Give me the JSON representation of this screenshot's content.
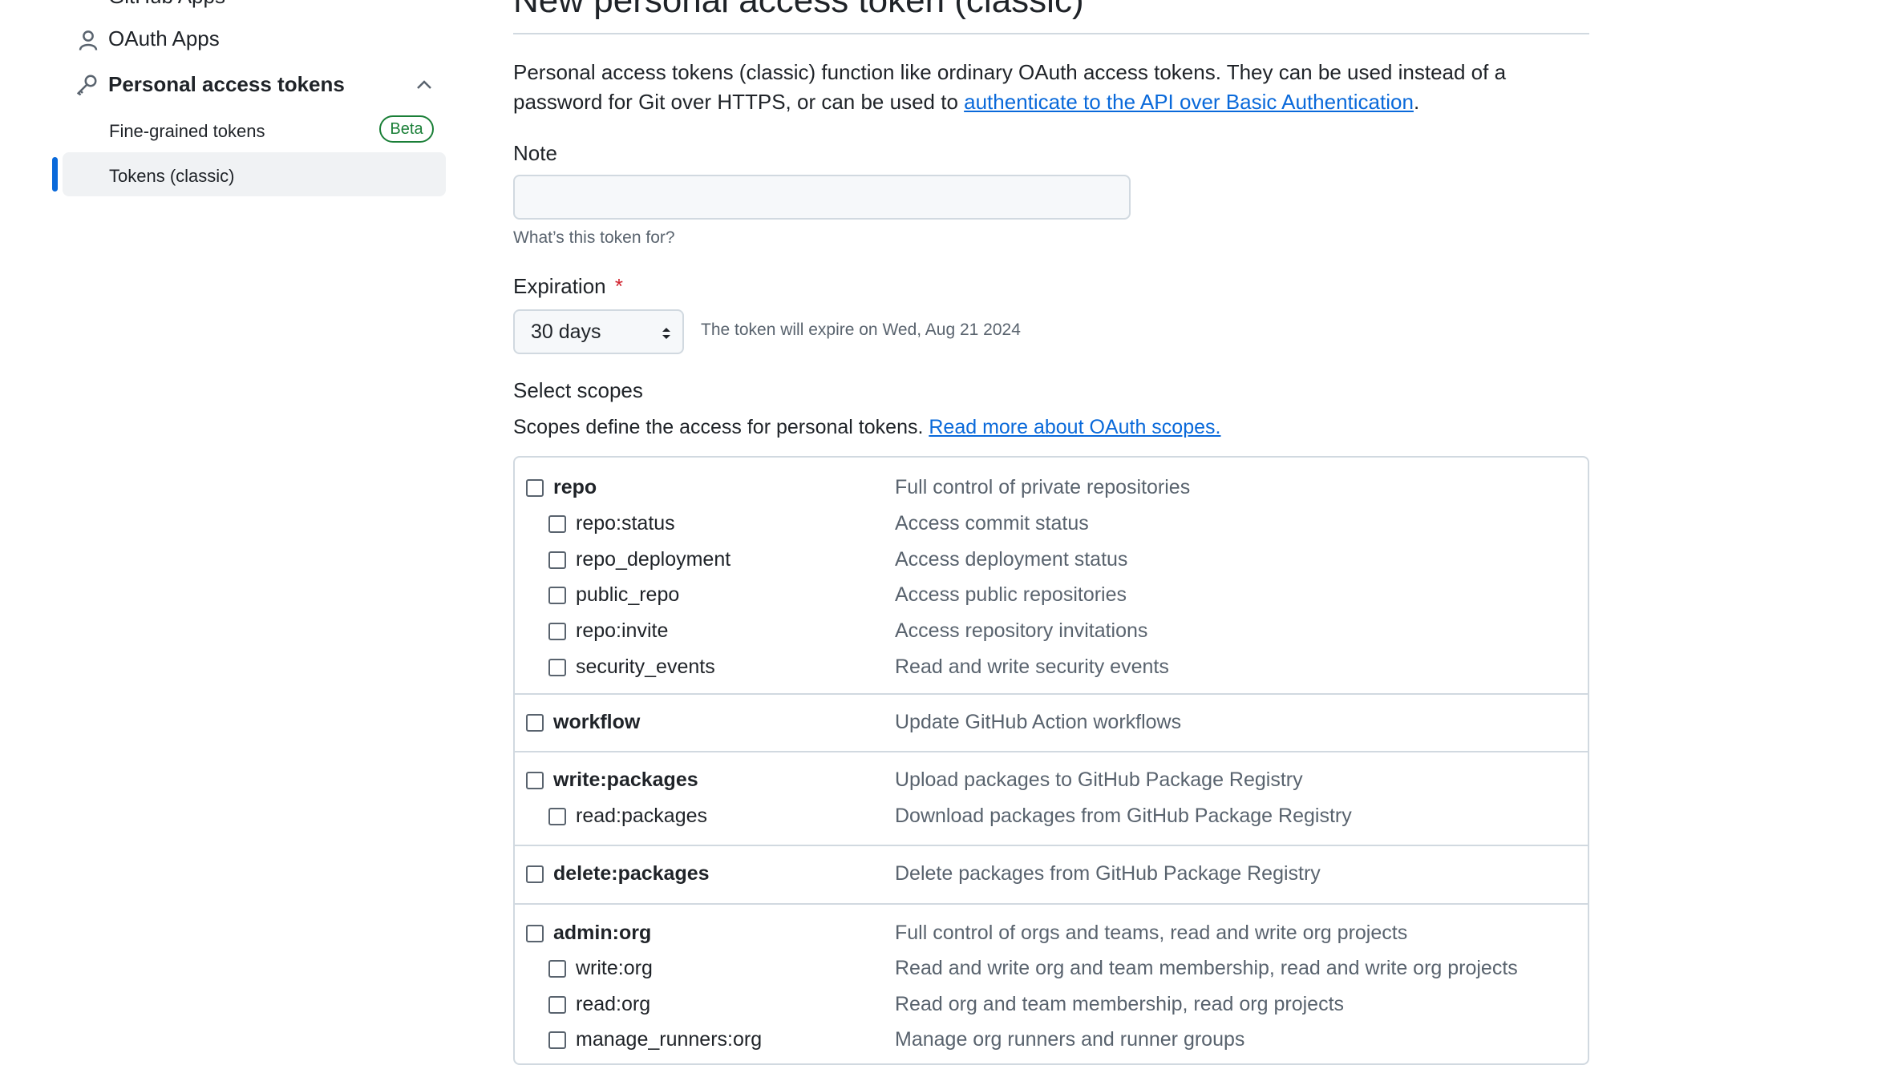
{
  "sidebar": {
    "cut_item": "GitHub Apps",
    "oauth_apps": "OAuth Apps",
    "personal_access_tokens": "Personal access tokens",
    "fine_grained": "Fine-grained tokens",
    "beta_badge": "Beta",
    "tokens_classic": "Tokens (classic)"
  },
  "main": {
    "title": "New personal access token (classic)",
    "intro_text": "Personal access tokens (classic) function like ordinary OAuth access tokens. They can be used instead of a password for Git over HTTPS, or can be used to ",
    "intro_link": "authenticate to the API over Basic Authentication",
    "intro_end": ".",
    "note_label": "Note",
    "note_value": "",
    "note_hint": "What’s this token for?",
    "expiration_label": "Expiration",
    "required_mark": "*",
    "expiration_value": "30 days",
    "expiration_hint": "The token will expire on Wed, Aug 21 2024",
    "scopes_title": "Select scopes",
    "scopes_text": "Scopes define the access for personal tokens. ",
    "scopes_link": "Read more about OAuth scopes."
  },
  "scopes": {
    "repo": {
      "name": "repo",
      "desc": "Full control of private repositories"
    },
    "repo_status": {
      "name": "repo:status",
      "desc": "Access commit status"
    },
    "repo_deployment": {
      "name": "repo_deployment",
      "desc": "Access deployment status"
    },
    "public_repo": {
      "name": "public_repo",
      "desc": "Access public repositories"
    },
    "repo_invite": {
      "name": "repo:invite",
      "desc": "Access repository invitations"
    },
    "security_events": {
      "name": "security_events",
      "desc": "Read and write security events"
    },
    "workflow": {
      "name": "workflow",
      "desc": "Update GitHub Action workflows"
    },
    "write_packages": {
      "name": "write:packages",
      "desc": "Upload packages to GitHub Package Registry"
    },
    "read_packages": {
      "name": "read:packages",
      "desc": "Download packages from GitHub Package Registry"
    },
    "delete_packages": {
      "name": "delete:packages",
      "desc": "Delete packages from GitHub Package Registry"
    },
    "admin_org": {
      "name": "admin:org",
      "desc": "Full control of orgs and teams, read and write org projects"
    },
    "write_org": {
      "name": "write:org",
      "desc": "Read and write org and team membership, read and write org projects"
    },
    "read_org": {
      "name": "read:org",
      "desc": "Read org and team membership, read org projects"
    },
    "manage_runners_org": {
      "name": "manage_runners:org",
      "desc": "Manage org runners and runner groups"
    }
  },
  "colors": {
    "accent": "#0969da",
    "beta": "#1a7f37",
    "required": "#d1242f"
  }
}
